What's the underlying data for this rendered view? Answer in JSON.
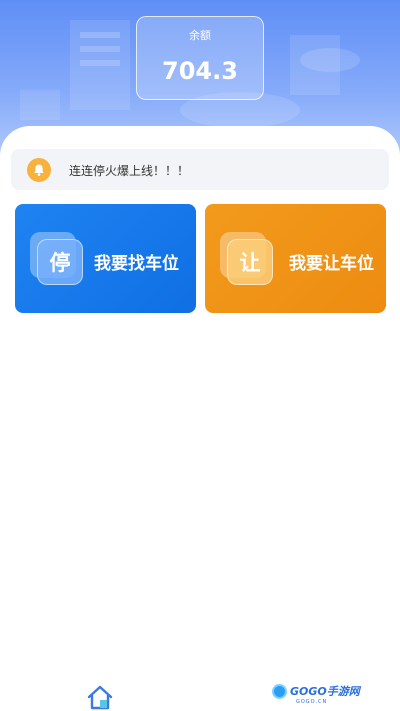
{
  "header": {
    "balance_label": "余额",
    "balance_value": "704.3"
  },
  "notice": {
    "icon": "bell-icon",
    "text": "连连停火爆上线！！！"
  },
  "actions": [
    {
      "tile_char": "停",
      "label": "我要找车位",
      "color": "#1577EC"
    },
    {
      "tile_char": "让",
      "label": "我要让车位",
      "color": "#EF9116"
    }
  ],
  "bottom_nav": {
    "home_icon": "home-icon",
    "watermark_text": "GOGO手游网",
    "watermark_sub": "GOGO.CN"
  },
  "colors": {
    "header_blue": "#6A96F7",
    "notice_icon": "#F6B23D"
  }
}
